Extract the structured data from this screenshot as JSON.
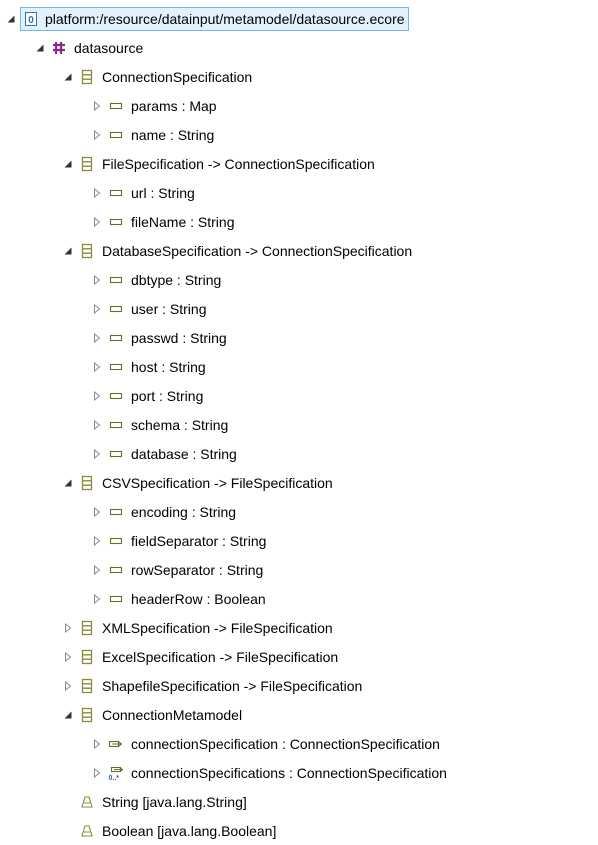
{
  "tree": {
    "resource": {
      "label": "platform:/resource/datainput/metamodel/datasource.ecore",
      "expanded": true,
      "icon": "ecore-resource-icon",
      "selected": true
    },
    "package": {
      "label": "datasource",
      "expanded": true,
      "icon": "epackage-icon"
    },
    "classes": [
      {
        "label": "ConnectionSpecification",
        "expanded": true,
        "icon": "eclass-icon",
        "features": [
          {
            "label": "params : Map",
            "kind": "attribute"
          },
          {
            "label": "name : String",
            "kind": "attribute"
          }
        ]
      },
      {
        "label": "FileSpecification -> ConnectionSpecification",
        "expanded": true,
        "icon": "eclass-icon",
        "features": [
          {
            "label": "url : String",
            "kind": "attribute"
          },
          {
            "label": "fileName : String",
            "kind": "attribute"
          }
        ]
      },
      {
        "label": "DatabaseSpecification -> ConnectionSpecification",
        "expanded": true,
        "icon": "eclass-icon",
        "features": [
          {
            "label": "dbtype : String",
            "kind": "attribute"
          },
          {
            "label": "user : String",
            "kind": "attribute"
          },
          {
            "label": "passwd : String",
            "kind": "attribute"
          },
          {
            "label": "host : String",
            "kind": "attribute"
          },
          {
            "label": "port : String",
            "kind": "attribute"
          },
          {
            "label": "schema : String",
            "kind": "attribute"
          },
          {
            "label": "database : String",
            "kind": "attribute"
          }
        ]
      },
      {
        "label": "CSVSpecification -> FileSpecification",
        "expanded": true,
        "icon": "eclass-icon",
        "features": [
          {
            "label": "encoding : String",
            "kind": "attribute"
          },
          {
            "label": "fieldSeparator : String",
            "kind": "attribute"
          },
          {
            "label": "rowSeparator : String",
            "kind": "attribute"
          },
          {
            "label": "headerRow : Boolean",
            "kind": "attribute"
          }
        ]
      },
      {
        "label": "XMLSpecification -> FileSpecification",
        "expanded": false,
        "icon": "eclass-icon",
        "features": []
      },
      {
        "label": "ExcelSpecification -> FileSpecification",
        "expanded": false,
        "icon": "eclass-icon",
        "features": []
      },
      {
        "label": "ShapefileSpecification -> FileSpecification",
        "expanded": false,
        "icon": "eclass-icon",
        "features": []
      },
      {
        "label": "ConnectionMetamodel",
        "expanded": true,
        "icon": "eclass-icon",
        "features": [
          {
            "label": "connectionSpecification : ConnectionSpecification",
            "kind": "reference"
          },
          {
            "label": "connectionSpecifications : ConnectionSpecification",
            "kind": "reference-many",
            "multiplicity": "0..*"
          }
        ]
      }
    ],
    "datatypes": [
      {
        "label": "String [java.lang.String]",
        "icon": "edatatype-icon"
      },
      {
        "label": "Boolean [java.lang.Boolean]",
        "icon": "edatatype-icon"
      }
    ]
  },
  "colors": {
    "selection_border": "#7ab5e6",
    "selection_fill": "#e3f1fc",
    "class_icon": "#8a8a3a",
    "attribute_icon": "#6b6b2e",
    "package_icon": "#8a2a8a",
    "resource_icon": "#3a6fb0",
    "toggle": "#555555"
  }
}
